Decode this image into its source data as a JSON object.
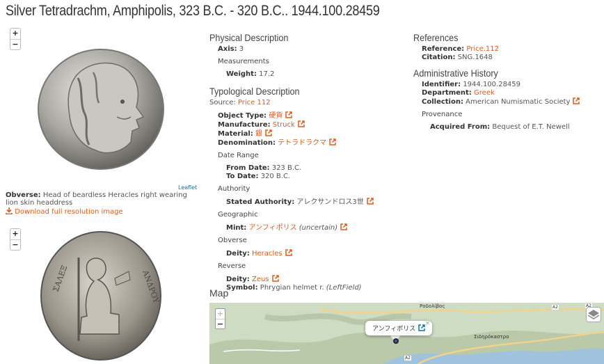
{
  "title": "Silver Tetradrachm, Amphipolis, 323 B.C. - 320 B.C.. 1944.100.28459",
  "viewer": {
    "zoom_in": "+",
    "zoom_out": "−",
    "leaflet": "Leaflet",
    "obverse_label": "Obverse:",
    "obverse_text": "Head of beardless Heracles right wearing lion skin headdress",
    "download": "Download full resolution image"
  },
  "physical": {
    "heading": "Physical Description",
    "axis_label": "Axis:",
    "axis_value": "3",
    "measurements": "Measurements",
    "weight_label": "Weight:",
    "weight_value": "17.2"
  },
  "typological": {
    "heading": "Typological Description",
    "source_label": "Source:",
    "source_value": "Price 112",
    "object_type_label": "Object Type:",
    "object_type_value": "硬貨",
    "manufacture_label": "Manufacture:",
    "manufacture_value": "Struck",
    "material_label": "Material:",
    "material_value": "銀",
    "denomination_label": "Denomination:",
    "denomination_value": "テトラドラクマ",
    "date_range": "Date Range",
    "from_label": "From Date:",
    "from_value": "323 B.C.",
    "to_label": "To Date:",
    "to_value": "320 B.C.",
    "authority": "Authority",
    "stated_label": "Stated Authority:",
    "stated_value": "アレクサンドロス3世",
    "geographic": "Geographic",
    "mint_label": "Mint:",
    "mint_value": "アンフィポリス",
    "mint_note": "(uncertain)",
    "obverse": "Obverse",
    "obv_deity_label": "Deity:",
    "obv_deity_value": "Heracles",
    "reverse": "Reverse",
    "rev_deity_label": "Deity:",
    "rev_deity_value": "Zeus",
    "symbol_label": "Symbol:",
    "symbol_value": "Phrygian helmet r.",
    "symbol_note": "(LeftField)"
  },
  "references": {
    "heading": "References",
    "reference_label": "Reference:",
    "reference_value": "Price.112",
    "citation_label": "Citation:",
    "citation_value": "SNG.1648"
  },
  "admin": {
    "heading": "Administrative History",
    "identifier_label": "Identifier:",
    "identifier_value": "1944.100.28459",
    "department_label": "Department:",
    "department_value": "Greek",
    "collection_label": "Collection:",
    "collection_value": "American Numismatic Society",
    "provenance": "Provenance",
    "acquired_label": "Acquired From:",
    "acquired_value": "Bequest of E.T. Newell"
  },
  "map": {
    "heading": "Map",
    "popup_text": "アンフィポリス",
    "close": "×",
    "places": [
      "Ροδολίβος",
      "Σιδηρόκαστρο"
    ],
    "road_labels": [
      "A2",
      "A2",
      "A2"
    ],
    "colors": {
      "land": "#cfdcc4",
      "sea": "#9fc3dc",
      "road": "#f3d28a"
    }
  }
}
